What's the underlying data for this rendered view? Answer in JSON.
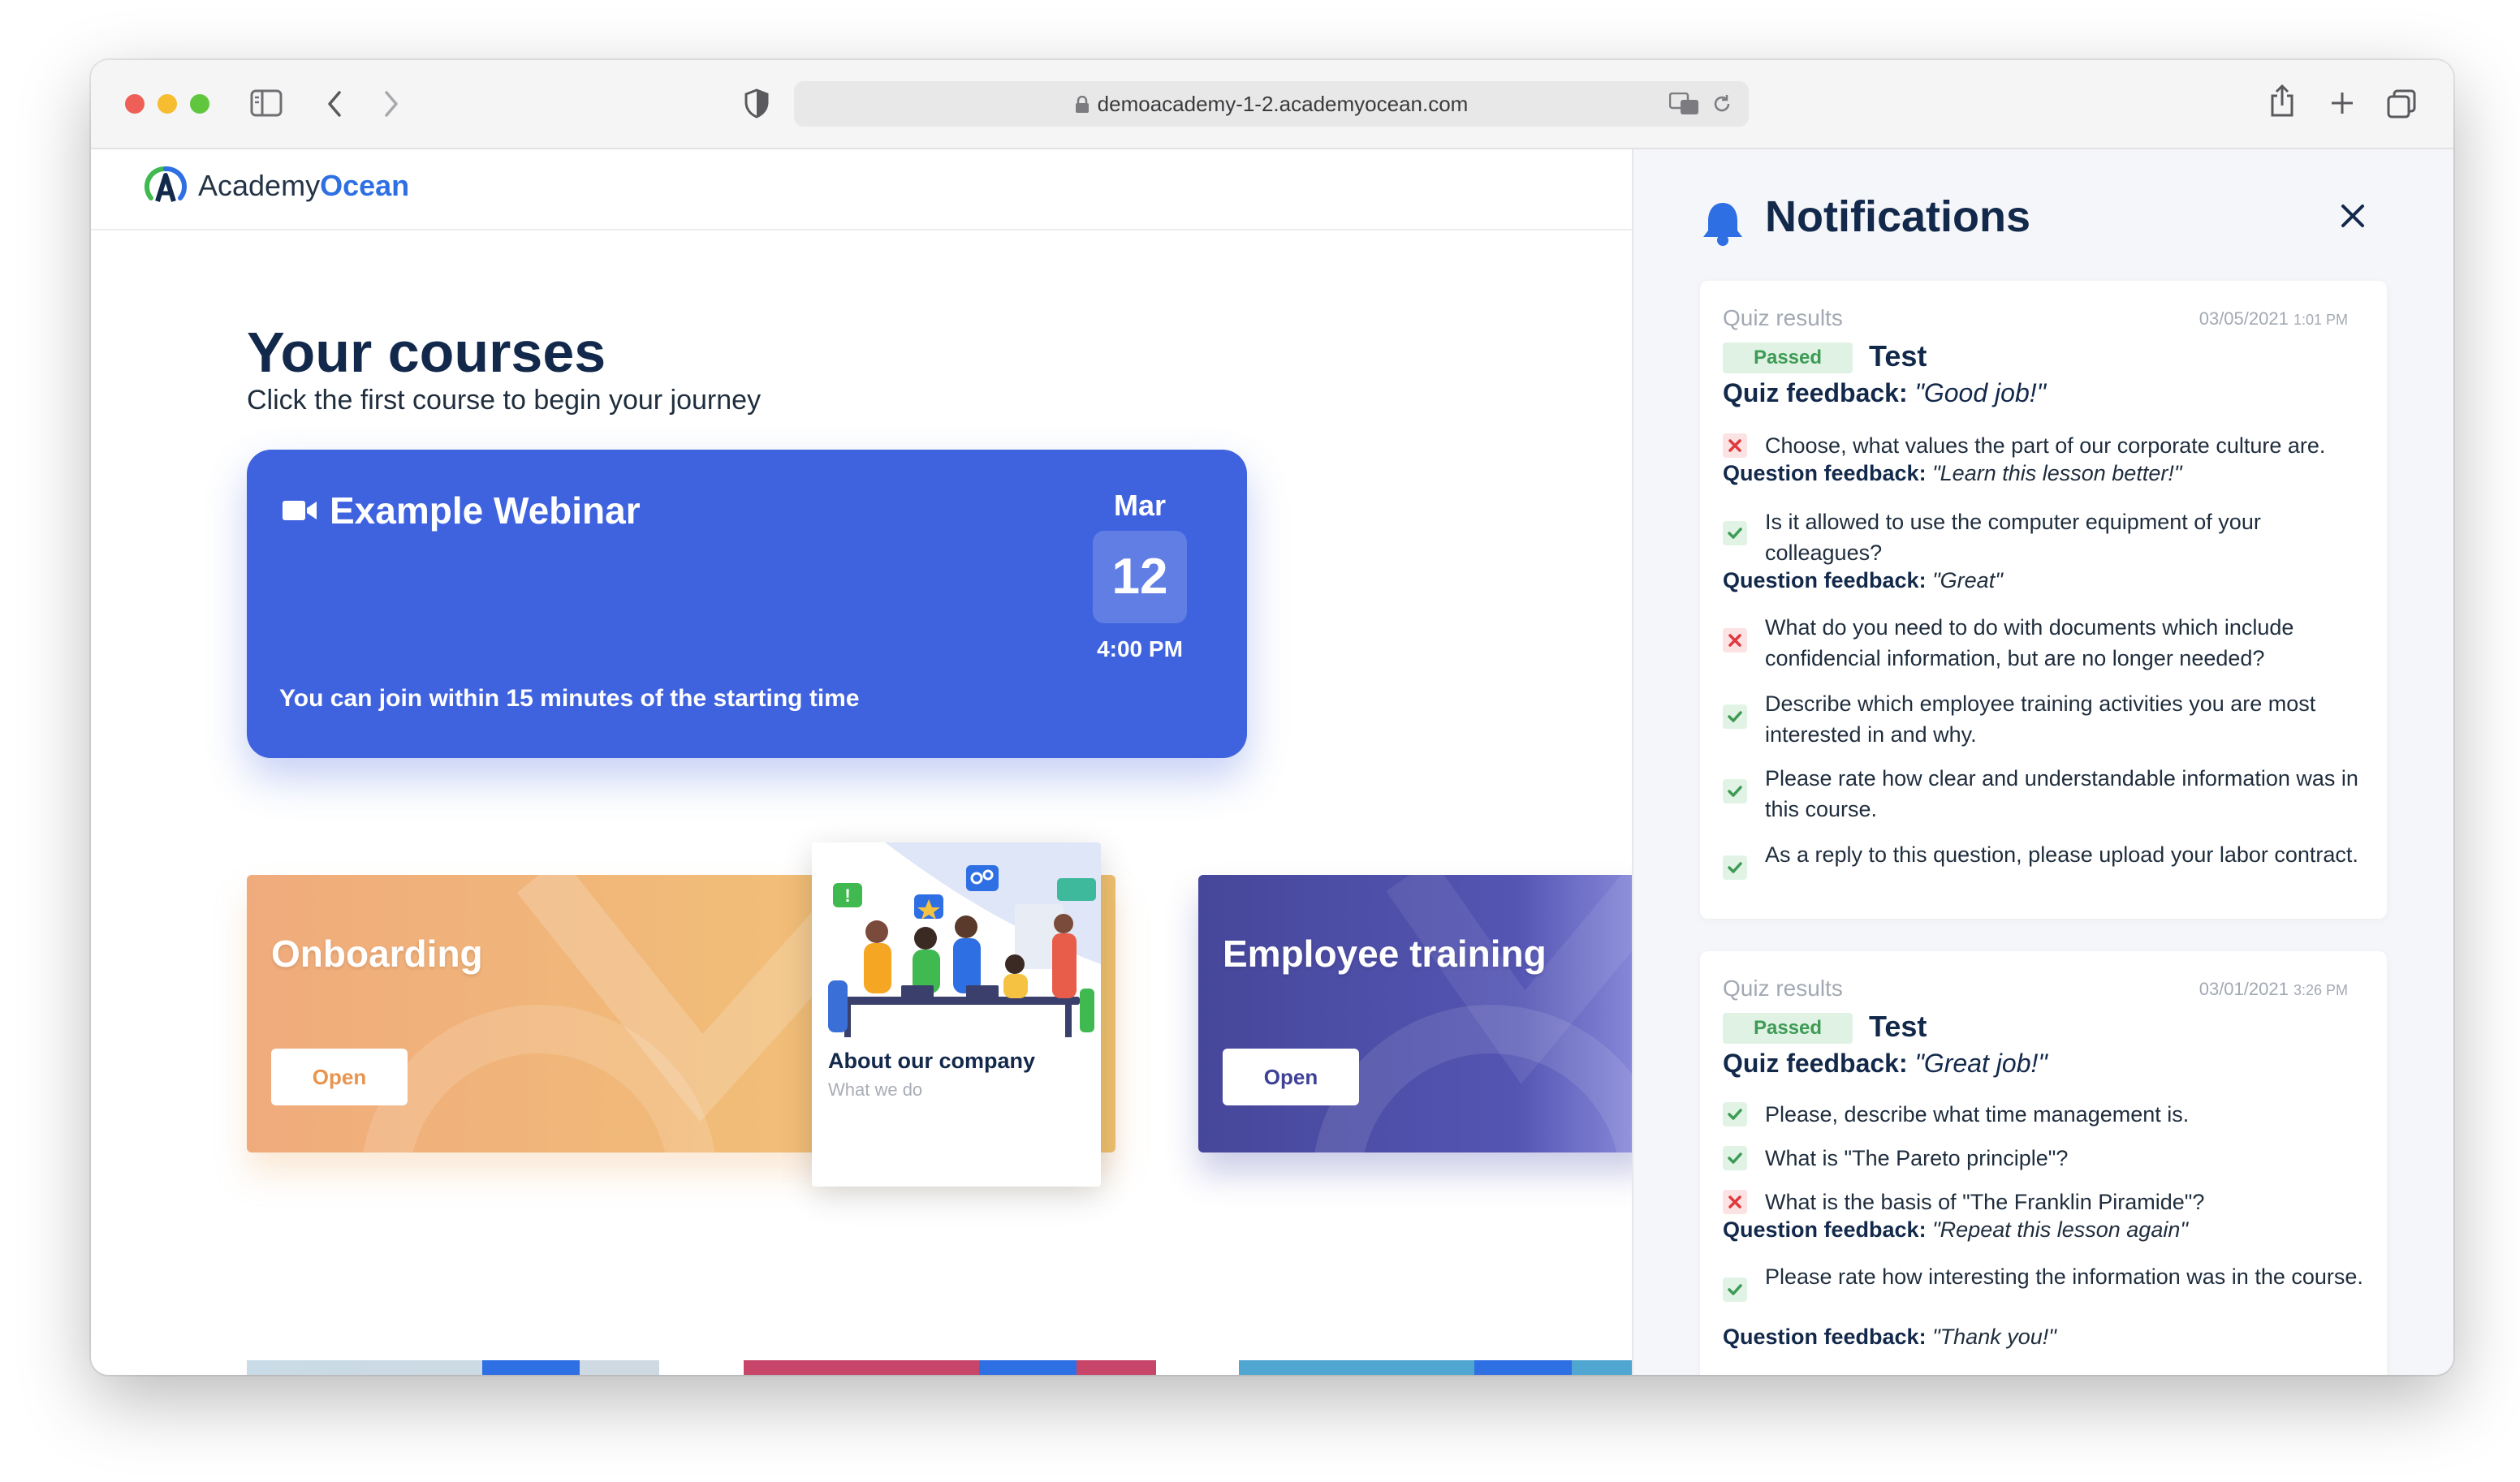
{
  "browser": {
    "url": "demoacademy-1-2.academyocean.com"
  },
  "brand": {
    "logo_prefix": "Academy",
    "logo_suffix": "Ocean",
    "accent": "#2f6fe4"
  },
  "main": {
    "heading": "Your courses",
    "subheading": "Click the first course to begin your journey",
    "webinar": {
      "title": "Example Webinar",
      "month": "Mar",
      "day": "12",
      "time": "4:00 PM",
      "note": "You can join within 15 minutes of the starting time",
      "color": "#3f62de"
    },
    "courses": [
      {
        "title": "Onboarding",
        "button": "Open",
        "color": "#f1b07a"
      },
      {
        "title": "Employee training",
        "button": "Open",
        "color": "#4c4fa8"
      }
    ],
    "about_card": {
      "title": "About our company",
      "subtitle": "What we do"
    }
  },
  "notifications": {
    "title": "Notifications",
    "items": [
      {
        "type": "Quiz results",
        "date": "03/05/2021",
        "time": "1:01 PM",
        "badge": "Passed",
        "test": "Test",
        "feedback_label": "Quiz feedback:",
        "feedback": "\"Good job!\"",
        "questions": [
          {
            "status": "wrong",
            "text": "Choose, what values the part of our corporate culture are.",
            "feedback_label": "Question feedback:",
            "feedback": "\"Learn this lesson better!\""
          },
          {
            "status": "correct",
            "text": "Is it allowed to use the computer equipment of your colleagues?",
            "feedback_label": "Question feedback:",
            "feedback": "\"Great\""
          },
          {
            "status": "wrong",
            "text": "What do you need to do with documents which include confidencial information, but are no longer needed?"
          },
          {
            "status": "correct",
            "text": "Describe which employee training activities you are most interested in and why."
          },
          {
            "status": "correct",
            "text": "Please rate how clear and understandable information was in this course."
          },
          {
            "status": "correct",
            "text": "As a reply to this question, please upload your labor contract."
          }
        ]
      },
      {
        "type": "Quiz results",
        "date": "03/01/2021",
        "time": "3:26 PM",
        "badge": "Passed",
        "test": "Test",
        "feedback_label": "Quiz feedback:",
        "feedback": "\"Great job!\"",
        "questions": [
          {
            "status": "correct",
            "text": "Please, describe what time management is."
          },
          {
            "status": "correct",
            "text": "What is \"The Pareto principle\"?"
          },
          {
            "status": "wrong",
            "text": "What is the basis of \"The Franklin Piramide\"?",
            "feedback_label": "Question feedback:",
            "feedback": "\"Repeat this lesson again\""
          },
          {
            "status": "correct",
            "text": "Please rate how interesting the information was in the course.",
            "feedback_label": "Question feedback:",
            "feedback": "\"Thank you!\""
          }
        ]
      }
    ]
  }
}
